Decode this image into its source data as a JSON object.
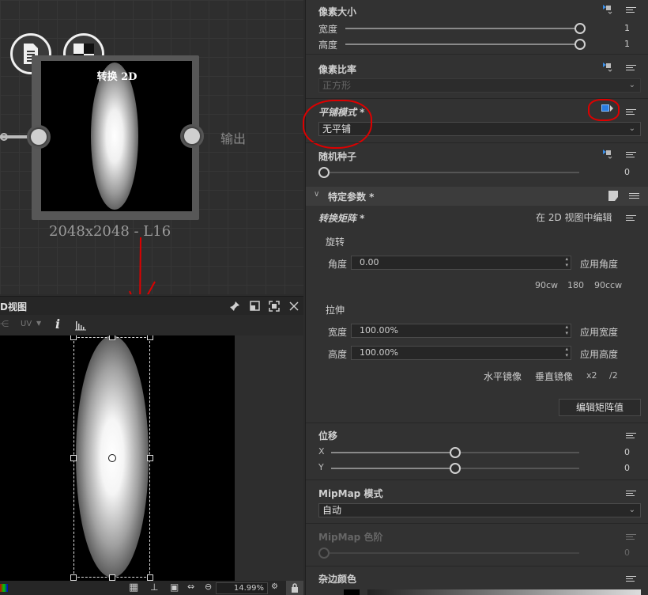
{
  "graph": {
    "node_title": "转换 2D",
    "output_label": "输出",
    "node_size": "2048x2048 - L16"
  },
  "view2d": {
    "title": "D视图",
    "uv_label": "UV",
    "zoom": "14.99%"
  },
  "params": {
    "pixel_size": {
      "title": "像素大小",
      "width_label": "宽度",
      "width_value": "1",
      "height_label": "高度",
      "height_value": "1"
    },
    "pixel_ratio": {
      "title": "像素比率",
      "value": "正方形"
    },
    "tiling": {
      "title": "平铺模式 *",
      "value": "无平铺"
    },
    "seed": {
      "title": "随机种子",
      "value": "0"
    },
    "specific": {
      "title": "特定参数 *"
    },
    "transform_matrix": {
      "title": "转换矩阵 *",
      "edit_in_2d": "在 2D 视图中编辑",
      "rotate_label": "旋转",
      "angle_label": "角度",
      "angle_value": "0.00",
      "apply_angle": "应用角度",
      "rot_90cw": "90cw",
      "rot_180": "180",
      "rot_90ccw": "90ccw",
      "stretch_label": "拉伸",
      "width_label": "宽度",
      "width_value": "100.00%",
      "apply_width": "应用宽度",
      "height_label": "高度",
      "height_value": "100.00%",
      "apply_height": "应用高度",
      "h_mirror": "水平镜像",
      "v_mirror": "垂直镜像",
      "x2": "x2",
      "div2": "/2",
      "edit_matrix": "编辑矩阵值"
    },
    "offset": {
      "title": "位移",
      "x_label": "X",
      "x_value": "0",
      "y_label": "Y",
      "y_value": "0"
    },
    "mipmap_mode": {
      "title": "MipMap 模式",
      "value": "自动"
    },
    "mipmap_level": {
      "title": "MipMap 色阶",
      "value": "0"
    },
    "matte_color": {
      "title": "杂边颜色"
    }
  },
  "colors": {
    "annotation_red": "#dd0000",
    "accent_blue": "#2a7de1"
  }
}
